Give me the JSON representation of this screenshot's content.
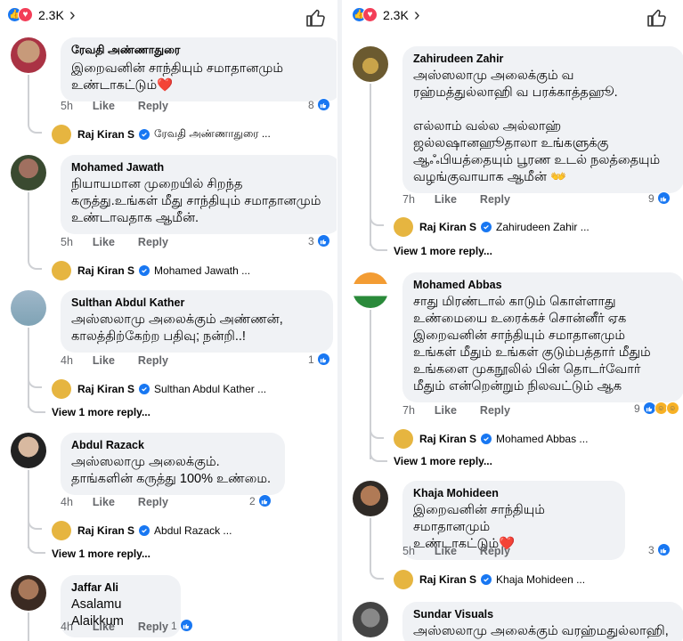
{
  "header": {
    "reaction_count": "2.3K"
  },
  "left": {
    "comments": [
      {
        "author": "ரேவதி அண்ணாதுரை",
        "text": "இறைவனின் சாந்தியும் சமாதானமும் உண்டாகட்டும்❤️",
        "time": "5h",
        "like": "Like",
        "reply": "Reply",
        "count": "8",
        "reply_author": "Raj Kiran S",
        "reply_target": "ரேவதி அண்ணாதுரை ..."
      },
      {
        "author": "Mohamed Jawath",
        "text": "நியாயமான முறையில் சிறந்த\nகருத்து.உங்கள் மீது சாந்தியும் சமாதானமும்\nஉண்டாவதாக ஆமீன்.",
        "time": "5h",
        "like": "Like",
        "reply": "Reply",
        "count": "3",
        "reply_author": "Raj Kiran S",
        "reply_target": "Mohamed Jawath ..."
      },
      {
        "author": "Sulthan Abdul Kather",
        "text": "அஸ்ஸலாமு அலைக்கும் அண்ணன்,\nகாலத்திற்கேற்ற பதிவு; நன்றி..!",
        "time": "4h",
        "like": "Like",
        "reply": "Reply",
        "count": "1",
        "reply_author": "Raj Kiran S",
        "reply_target": "Sulthan Abdul Kather ...",
        "view_more": "View 1 more reply..."
      },
      {
        "author": "Abdul Razack",
        "text": "அஸ்ஸலாமு அலைக்கும்.\nதாங்களின் கருத்து 100% உண்மை.",
        "time": "4h",
        "like": "Like",
        "reply": "Reply",
        "count": "2",
        "reply_author": "Raj Kiran S",
        "reply_target": "Abdul Razack ...",
        "view_more": "View 1 more reply..."
      },
      {
        "author": "Jaffar Ali",
        "text": "Asalamu Alaikkum",
        "time": "4h",
        "like": "Like",
        "reply": "Reply",
        "count": "1"
      }
    ]
  },
  "right": {
    "comments": [
      {
        "author": "Zahirudeen Zahir",
        "text": "அஸ்ஸலாமு அலைக்கும் வ\nரஹ்மத்துல்லாஹி வ பரக்காத்தஹூ.\n\nஎல்லாம் வல்ல அல்லாஹ்\nஜல்லஷானஹூதாலா உங்களுக்கு\nஆஃபியத்தையும் பூரண உடல் நலத்தையும்\nவழங்குவாயாக ஆமீன் 👐",
        "time": "7h",
        "like": "Like",
        "reply": "Reply",
        "count": "9",
        "reply_author": "Raj Kiran S",
        "reply_target": "Zahirudeen Zahir ...",
        "view_more": "View 1 more reply..."
      },
      {
        "author": "Mohamed Abbas",
        "text": "சாது மிரண்டால் காடும் கொள்ளாது\nஉண்மையை உரைக்கச் சொன்னீர் ஏக\nஇறைவனின் சாந்தியும் சமாதானமும்\nஉங்கள் மீதும் உங்கள் குடும்பத்தார் மீதும்\nஉங்களை முகநூலில் பின் தொடர்வோர்\nமீதும் என்றென்றும் நிலவட்டும் ஆக",
        "time": "7h",
        "like": "Like",
        "reply": "Reply",
        "count": "9",
        "reply_author": "Raj Kiran S",
        "reply_target": "Mohamed Abbas ...",
        "view_more": "View 1 more reply..."
      },
      {
        "author": "Khaja Mohideen",
        "text": "இறைவனின் சாந்தியும் சமாதானமும்\nஉண்டாகட்டும்❤️",
        "time": "5h",
        "like": "Like",
        "reply": "Reply",
        "count": "3",
        "reply_author": "Raj Kiran S",
        "reply_target": "Khaja Mohideen ..."
      },
      {
        "author": "Sundar Visuals",
        "text": "அஸ்ஸலாமு அலைக்கும் வரஹ்மதுல்லாஹி,",
        "time": "",
        "like": "",
        "reply": ""
      }
    ]
  },
  "colors": {
    "accent": "#1877f2",
    "bubble": "#f0f2f5",
    "love": "#f33e58",
    "muted": "#65676b"
  }
}
